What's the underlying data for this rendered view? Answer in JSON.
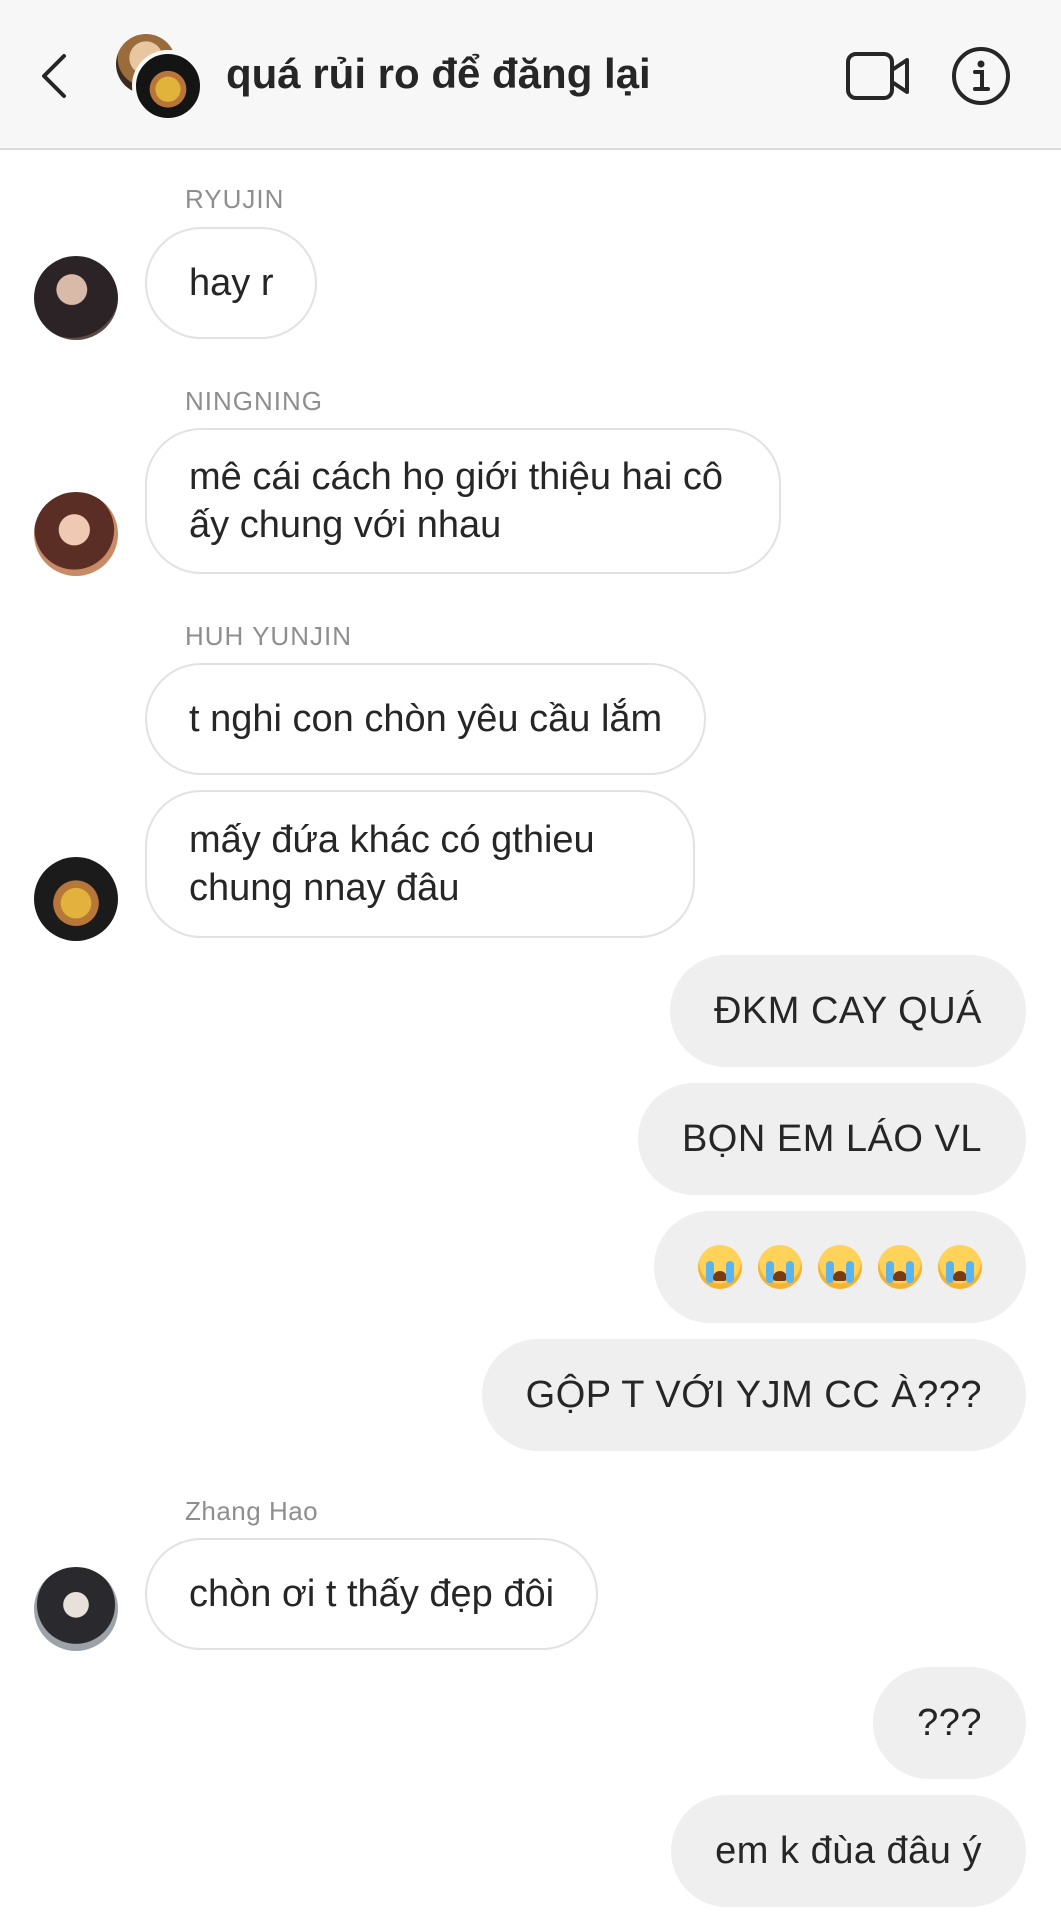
{
  "header": {
    "title": "quá rủi ro để đăng lại",
    "back_icon": "chevron-left-icon",
    "video_icon": "video-camera-icon",
    "info_icon": "info-icon"
  },
  "messages": [
    {
      "sender": "RYUJIN",
      "text": "hay r"
    },
    {
      "sender": "NINGNING",
      "text": "mê cái cách họ giới thiệu hai cô ấy chung với nhau"
    },
    {
      "sender": "HUH YUNJIN",
      "text": "t nghi con chòn yêu cầu lắm"
    },
    {
      "text": "mấy đứa khác có gthieu chung nnay đâu"
    },
    {
      "outgoing": true,
      "text": "ĐKM CAY QUÁ"
    },
    {
      "outgoing": true,
      "text": "BỌN EM LÁO VL"
    },
    {
      "outgoing": true,
      "emoji": "loudly-crying-face",
      "count": 5
    },
    {
      "outgoing": true,
      "text": "GỘP T VỚI YJM CC À???"
    },
    {
      "sender": "Zhang Hao",
      "text": "chòn ơi t thấy đẹp đôi"
    },
    {
      "outgoing": true,
      "text": "???"
    },
    {
      "outgoing": true,
      "text": "em k đùa đâu ý"
    }
  ],
  "colors": {
    "header_bg": "#f7f7f7",
    "incoming_bubble_bg": "#ffffff",
    "incoming_bubble_border": "#e2e2e2",
    "outgoing_bubble_bg": "#efefef",
    "sender_label": "#8e8e8e",
    "text": "#262626"
  }
}
